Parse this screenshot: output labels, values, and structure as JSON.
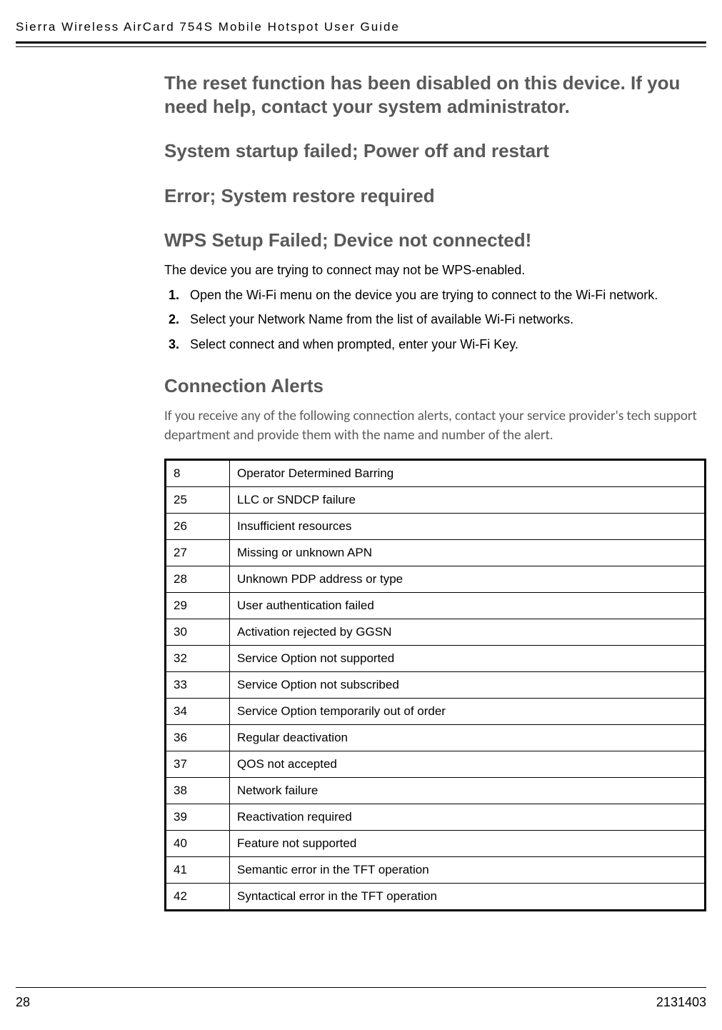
{
  "header": {
    "running_head": "Sierra Wireless AirCard 754S Mobile Hotspot User Guide"
  },
  "headings": {
    "h1": "The reset function has been disabled on this device. If you need help, contact your system administrator.",
    "h2": "System startup failed; Power off and restart",
    "h3": "Error; System restore required",
    "h4": "WPS Setup Failed; Device not connected!",
    "h5": "Connection Alerts"
  },
  "wps": {
    "intro": "The device you are trying to connect may not be WPS-enabled.",
    "steps": [
      "Open the Wi-Fi menu on the device you are trying to connect to the Wi-Fi network.",
      "Select your Network Name from the list of available Wi-Fi networks.",
      "Select connect and when prompted, enter your Wi-Fi Key."
    ]
  },
  "connection_alerts": {
    "intro": "If you receive any of the following connection alerts, contact your service provider's tech support department and provide them with the name and number of the alert.",
    "rows": [
      {
        "num": "8",
        "desc": "Operator Determined Barring"
      },
      {
        "num": "25",
        "desc": "LLC or SNDCP failure"
      },
      {
        "num": "26",
        "desc": "Insufficient resources"
      },
      {
        "num": "27",
        "desc": "Missing or unknown APN"
      },
      {
        "num": "28",
        "desc": "Unknown PDP address or type"
      },
      {
        "num": "29",
        "desc": "User authentication failed"
      },
      {
        "num": "30",
        "desc": "Activation rejected by GGSN"
      },
      {
        "num": "32",
        "desc": "Service Option not supported"
      },
      {
        "num": "33",
        "desc": "Service Option not subscribed"
      },
      {
        "num": "34",
        "desc": "Service Option temporarily out of order"
      },
      {
        "num": "36",
        "desc": "Regular deactivation"
      },
      {
        "num": "37",
        "desc": "QOS not accepted"
      },
      {
        "num": "38",
        "desc": "Network failure"
      },
      {
        "num": "39",
        "desc": "Reactivation required"
      },
      {
        "num": "40",
        "desc": "Feature not supported"
      },
      {
        "num": "41",
        "desc": "Semantic error in the TFT operation"
      },
      {
        "num": "42",
        "desc": "Syntactical error in the TFT operation"
      }
    ]
  },
  "footer": {
    "page": "28",
    "docnum": "2131403"
  }
}
